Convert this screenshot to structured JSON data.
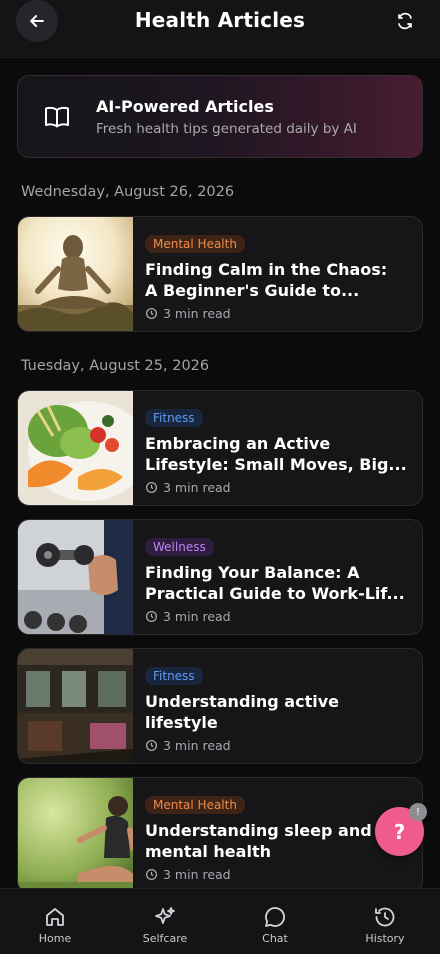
{
  "header": {
    "title": "Health Articles",
    "back_icon": "arrow-left-icon",
    "refresh_icon": "refresh-icon"
  },
  "banner": {
    "icon": "open-book-icon",
    "title": "AI-Powered Articles",
    "subtitle": "Fresh health tips generated daily by AI"
  },
  "sections": [
    {
      "date": "Wednesday, August 26, 2026",
      "articles": [
        {
          "tag": "Mental Health",
          "tag_type": "mental",
          "title": "Finding Calm in the Chaos:\nA Beginner's Guide to...",
          "read_time": "3 min read",
          "image": "meditation-silhouette"
        }
      ]
    },
    {
      "date": "Tuesday, August 25, 2026",
      "articles": [
        {
          "tag": "Fitness",
          "tag_type": "fitness",
          "title": "Embracing an Active\nLifestyle: Small Moves, Big...",
          "read_time": "3 min read",
          "image": "salad-plate"
        },
        {
          "tag": "Wellness",
          "tag_type": "wellness",
          "title": "Finding Your Balance: A\nPractical Guide to Work-Lif...",
          "read_time": "3 min read",
          "image": "dumbbell-arm"
        },
        {
          "tag": "Fitness",
          "tag_type": "fitness",
          "title": "Understanding active\nlifestyle",
          "read_time": "3 min read",
          "image": "train-interior"
        },
        {
          "tag": "Mental Health",
          "tag_type": "mental",
          "title": "Understanding sleep and\nmental health",
          "read_time": "3 min read",
          "image": "woman-meditating-outdoors"
        }
      ]
    }
  ],
  "fab": {
    "label": "?",
    "badge": "!"
  },
  "nav": [
    {
      "label": "Home",
      "icon": "home-icon"
    },
    {
      "label": "Selfcare",
      "icon": "sparkles-icon"
    },
    {
      "label": "Chat",
      "icon": "chat-bubble-icon"
    },
    {
      "label": "History",
      "icon": "history-icon"
    }
  ],
  "colors": {
    "accent": "#ef5b8c",
    "background": "#0b0b0c",
    "card": "#161618"
  }
}
